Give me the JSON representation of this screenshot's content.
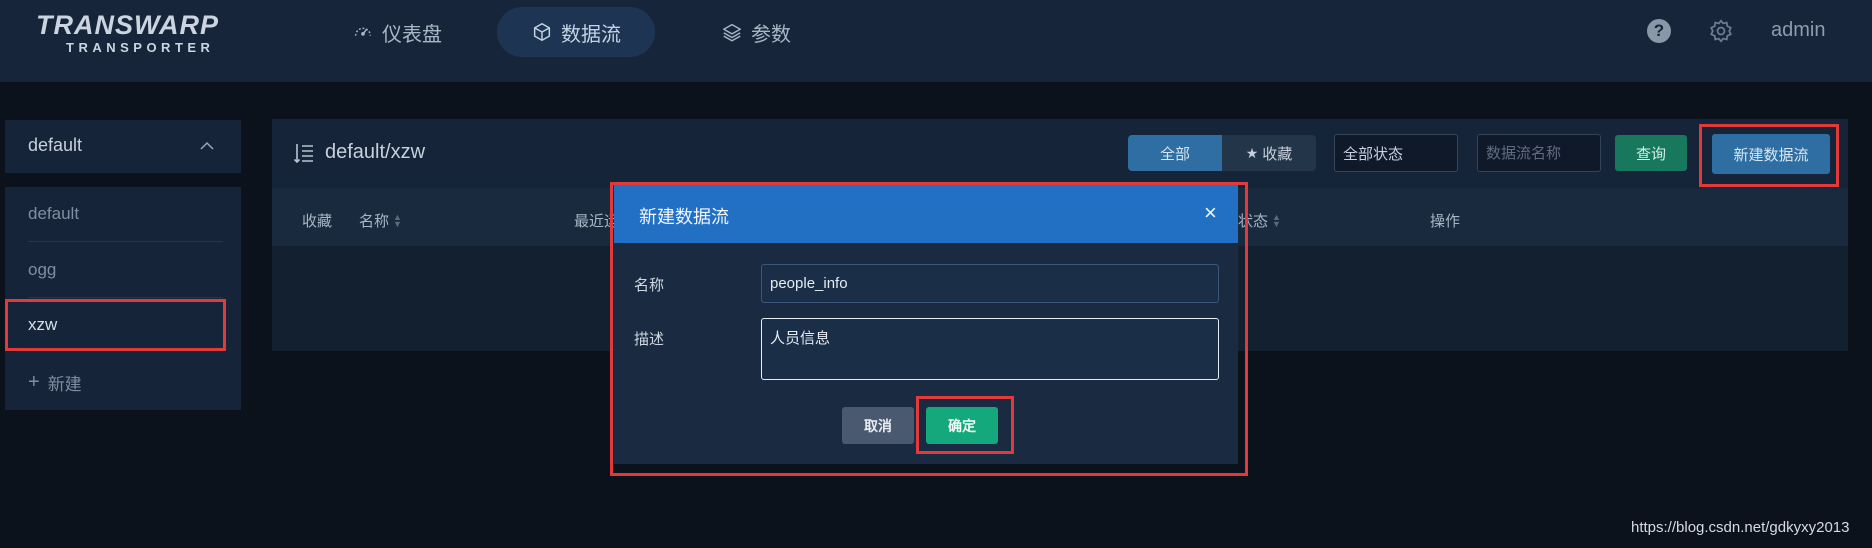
{
  "brand": {
    "logo_top": "TRANSWARP",
    "logo_bottom": "TRANSPORTER"
  },
  "nav": [
    {
      "label": "仪表盘",
      "icon": "dashboard-icon",
      "active": false
    },
    {
      "label": "数据流",
      "icon": "cube-icon",
      "active": true
    },
    {
      "label": "参数",
      "icon": "layers-icon",
      "active": false
    }
  ],
  "header": {
    "help_glyph": "?",
    "user": "admin"
  },
  "sidebar": {
    "group": "default",
    "items": [
      {
        "label": "default",
        "selected": false
      },
      {
        "label": "ogg",
        "selected": false
      },
      {
        "label": "xzw",
        "selected": true
      }
    ],
    "add_label": "新建"
  },
  "main": {
    "breadcrumb": "default/xzw",
    "filters": {
      "all": "全部",
      "favorite": "收藏"
    },
    "status_select": "全部状态",
    "name_placeholder": "数据流名称",
    "query_button": "查询",
    "new_button": "新建数据流",
    "columns": [
      "收藏",
      "名称",
      "最近运",
      "状态",
      "操作"
    ]
  },
  "modal": {
    "title": "新建数据流",
    "close_glyph": "×",
    "name_label": "名称",
    "name_value": "people_info",
    "desc_label": "描述",
    "desc_value": "人员信息",
    "cancel": "取消",
    "confirm": "确定"
  },
  "watermark": "https://blog.csdn.net/gdkyxy2013",
  "colors": {
    "header_bg": "#16253a",
    "accent_blue": "#2e6ea2",
    "modal_header": "#2170c3",
    "confirm_green": "#14a87c",
    "highlight_red": "#e23a3a"
  }
}
